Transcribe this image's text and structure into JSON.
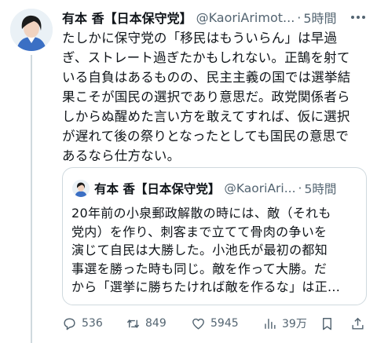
{
  "tweet": {
    "author_name": "有本 香【日本保守党】",
    "handle": "@KaoriArimot...",
    "separator": "·",
    "time": "5時間",
    "text_lines": [
      "たしかに保守党の「移民はもういらん」は早過",
      "ぎ、ストレート過ぎたかもしれない。正鵠を射て",
      "いる自負はあるものの、民主主義の国では選挙結",
      "果こそが国民の選択であり意思だ。政党関係者ら",
      "しからぬ醒めた言い方を敢えてすれば、仮に選択",
      "が遅れて後の祭りとなったとしても国民の意思で",
      "あるなら仕方ない。"
    ]
  },
  "quote": {
    "author_name": "有本 香【日本保守党】",
    "handle": "@KaoriAri...",
    "separator": "·",
    "time": "5時間",
    "text_lines": [
      "20年前の小泉郵政解散の時には、敵（それも",
      "党内）を作り、刺客まで立てて骨肉の争いを",
      "演じて自民は大勝した。小池氏が最初の都知",
      "事選を勝った時も同じ。敵を作って大勝。だ",
      "から「選挙に勝ちたければ敵を作るな」は正..."
    ]
  },
  "actions": {
    "replies": "536",
    "reposts": "849",
    "likes": "5945",
    "views": "39万"
  },
  "colors": {
    "text": "#0f1419",
    "secondary": "#536471",
    "border": "#cfd9de"
  }
}
